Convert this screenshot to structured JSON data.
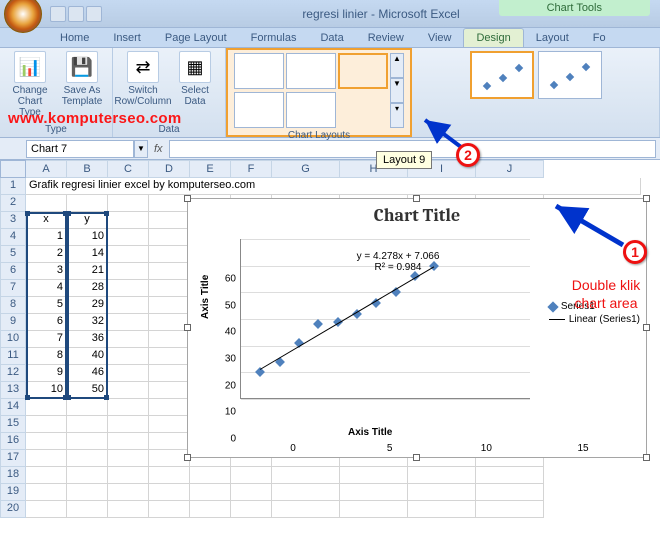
{
  "title_bar": {
    "app_title": "regresi linier - Microsoft Excel",
    "chart_tools": "Chart Tools"
  },
  "tabs": [
    "Home",
    "Insert",
    "Page Layout",
    "Formulas",
    "Data",
    "Review",
    "View",
    "Design",
    "Layout",
    "Fo"
  ],
  "active_tab": 7,
  "ribbon": {
    "group1": {
      "label": "Type",
      "btns": [
        {
          "label": "Change Chart Type",
          "icon": "📊"
        },
        {
          "label": "Save As Template",
          "icon": "📊"
        }
      ]
    },
    "group2": {
      "label": "Data",
      "btns": [
        {
          "label": "Switch Row/Column",
          "icon": "🔀"
        },
        {
          "label": "Select Data",
          "icon": "▦"
        }
      ]
    },
    "group3": {
      "label": "Chart Layouts"
    }
  },
  "name_box": "Chart 7",
  "fx": "fx",
  "tooltip": "Layout 9",
  "watermark": "www.komputerseo.com",
  "col_headers": [
    "A",
    "B",
    "C",
    "D",
    "E",
    "F",
    "G",
    "H",
    "I",
    "J"
  ],
  "rows": [
    {
      "n": "1",
      "a": "Grafik regresi linier excel by komputerseo.com"
    },
    {
      "n": "2"
    },
    {
      "n": "3",
      "a": "x",
      "b": "y"
    },
    {
      "n": "4",
      "a": "1",
      "b": "10"
    },
    {
      "n": "5",
      "a": "2",
      "b": "14"
    },
    {
      "n": "6",
      "a": "3",
      "b": "21"
    },
    {
      "n": "7",
      "a": "4",
      "b": "28"
    },
    {
      "n": "8",
      "a": "5",
      "b": "29"
    },
    {
      "n": "9",
      "a": "6",
      "b": "32"
    },
    {
      "n": "10",
      "a": "7",
      "b": "36"
    },
    {
      "n": "11",
      "a": "8",
      "b": "40"
    },
    {
      "n": "12",
      "a": "9",
      "b": "46"
    },
    {
      "n": "13",
      "a": "10",
      "b": "50"
    },
    {
      "n": "14"
    },
    {
      "n": "15"
    },
    {
      "n": "16"
    },
    {
      "n": "17"
    },
    {
      "n": "18"
    },
    {
      "n": "19"
    },
    {
      "n": "20"
    }
  ],
  "chart": {
    "title": "Chart Title",
    "axis_y": "Axis Title",
    "axis_x": "Axis Title",
    "equation": "y = 4.278x + 7.066",
    "r2": "R² = 0.984",
    "legend_series": "Series1",
    "legend_trend": "Linear (Series1)",
    "y_ticks": [
      "0",
      "10",
      "20",
      "30",
      "40",
      "50",
      "60"
    ],
    "x_ticks": [
      "0",
      "5",
      "10",
      "15"
    ]
  },
  "annot": {
    "one": "1",
    "two": "2",
    "text1": "Double klik",
    "text2": "chart area"
  },
  "chart_data": {
    "type": "scatter",
    "title": "Chart Title",
    "xlabel": "Axis Title",
    "ylabel": "Axis Title",
    "xlim": [
      0,
      15
    ],
    "ylim": [
      0,
      60
    ],
    "series": [
      {
        "name": "Series1",
        "x": [
          1,
          2,
          3,
          4,
          5,
          6,
          7,
          8,
          9,
          10
        ],
        "y": [
          10,
          14,
          21,
          28,
          29,
          32,
          36,
          40,
          46,
          50
        ]
      }
    ],
    "trendline": {
      "name": "Linear (Series1)",
      "slope": 4.278,
      "intercept": 7.066,
      "r2": 0.984
    }
  }
}
